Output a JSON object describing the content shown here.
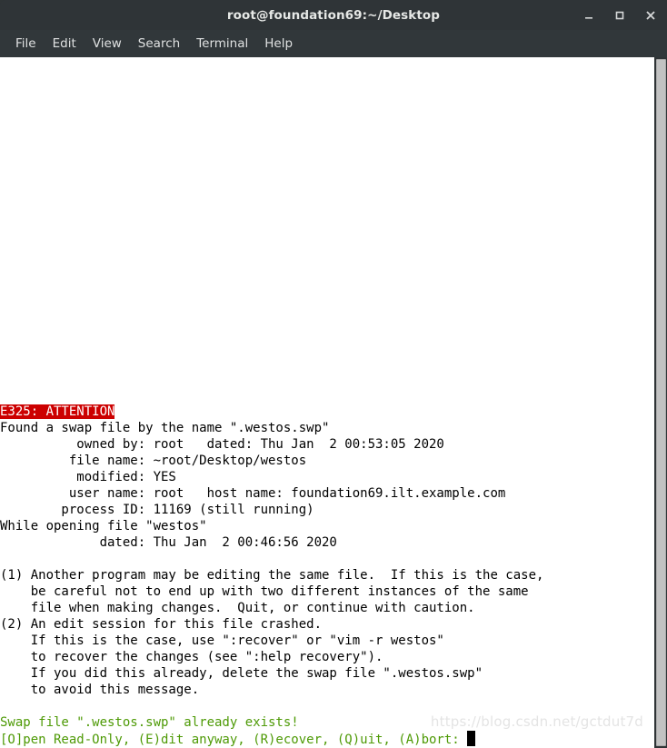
{
  "window": {
    "title": "root@foundation69:~/Desktop",
    "controls": {
      "minimize_label": "Minimize",
      "maximize_label": "Maximize",
      "close_label": "Close"
    }
  },
  "menubar": {
    "items": [
      {
        "label": "File"
      },
      {
        "label": "Edit"
      },
      {
        "label": "View"
      },
      {
        "label": "Search"
      },
      {
        "label": "Terminal"
      },
      {
        "label": "Help"
      }
    ]
  },
  "terminal": {
    "banner": "E325: ATTENTION",
    "lines": [
      "Found a swap file by the name \".westos.swp\"",
      "          owned by: root   dated: Thu Jan  2 00:53:05 2020",
      "         file name: ~root/Desktop/westos",
      "          modified: YES",
      "         user name: root   host name: foundation69.ilt.example.com",
      "        process ID: 11169 (still running)",
      "While opening file \"westos\"",
      "             dated: Thu Jan  2 00:46:56 2020",
      "",
      "(1) Another program may be editing the same file.  If this is the case,",
      "    be careful not to end up with two different instances of the same",
      "    file when making changes.  Quit, or continue with caution.",
      "(2) An edit session for this file crashed.",
      "    If this is the case, use \":recover\" or \"vim -r westos\"",
      "    to recover the changes (see \":help recovery\").",
      "    If you did this already, delete the swap file \".westos.swp\"",
      "    to avoid this message.",
      ""
    ],
    "swap_exists_line": "Swap file \".westos.swp\" already exists!",
    "prompt_line": "[O]pen Read-Only, (E)dit anyway, (R)ecover, (Q)uit, (A)bort: ",
    "colors": {
      "background": "#ffffff",
      "foreground": "#000000",
      "banner_background": "#cc0000",
      "banner_foreground": "#ffffff",
      "green": "#4e9a06",
      "cursor": "#000000"
    }
  },
  "watermark": {
    "text": "https://blog.csdn.net/gctdut7d"
  }
}
